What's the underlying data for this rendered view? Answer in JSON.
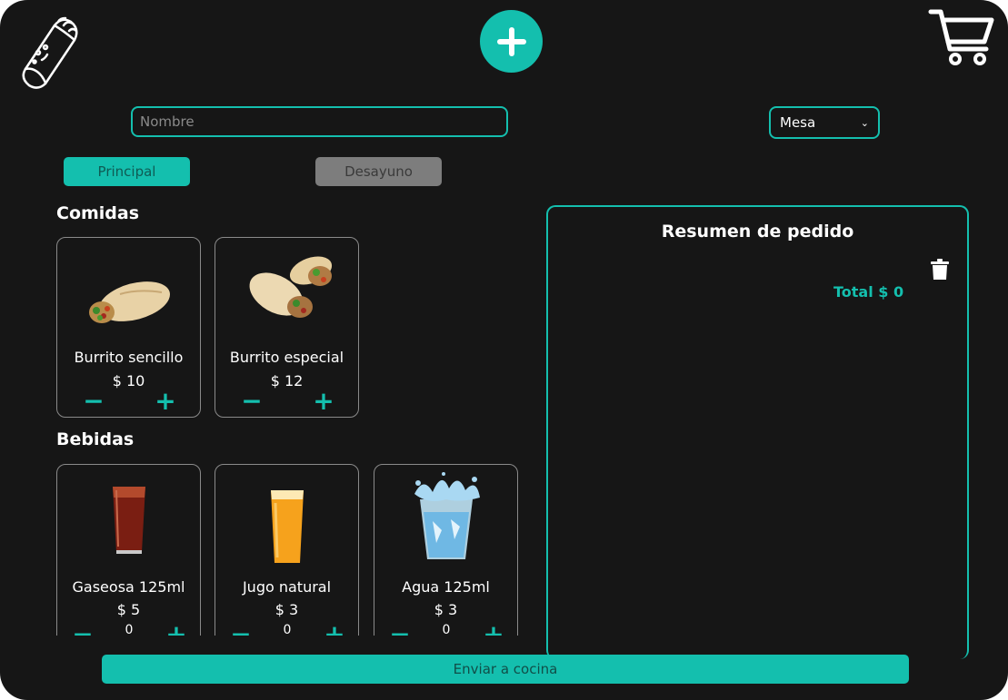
{
  "header": {
    "logo_icon": "burrito-logo-icon",
    "add_icon": "plus-icon",
    "cart_icon": "shopping-cart-icon",
    "accent_color": "#14bfae"
  },
  "form": {
    "name_placeholder": "Nombre",
    "name_value": "",
    "mesa_selected": "Mesa"
  },
  "tabs": [
    {
      "label": "Principal",
      "active": true
    },
    {
      "label": "Desayuno",
      "active": false
    }
  ],
  "sections": {
    "comidas": {
      "title": "Comidas",
      "items": [
        {
          "name": "Burrito sencillo",
          "price": "$ 10",
          "image_icon": "burrito-image"
        },
        {
          "name": "Burrito especial",
          "price": "$ 12",
          "image_icon": "burrito-special-image"
        }
      ]
    },
    "bebidas": {
      "title": "Bebidas",
      "items": [
        {
          "name": "Gaseosa 125ml",
          "price": "$ 5",
          "qty": "0",
          "image_icon": "soda-glass-image"
        },
        {
          "name": "Jugo natural",
          "price": "$ 3",
          "qty": "0",
          "image_icon": "juice-glass-image"
        },
        {
          "name": "Agua 125ml",
          "price": "$ 3",
          "qty": "0",
          "image_icon": "water-glass-image"
        }
      ]
    }
  },
  "summary": {
    "title": "Resumen de pedido",
    "total": "Total $ 0",
    "trash_icon": "trash-icon"
  },
  "footer": {
    "send_label": "Enviar a cocina"
  }
}
